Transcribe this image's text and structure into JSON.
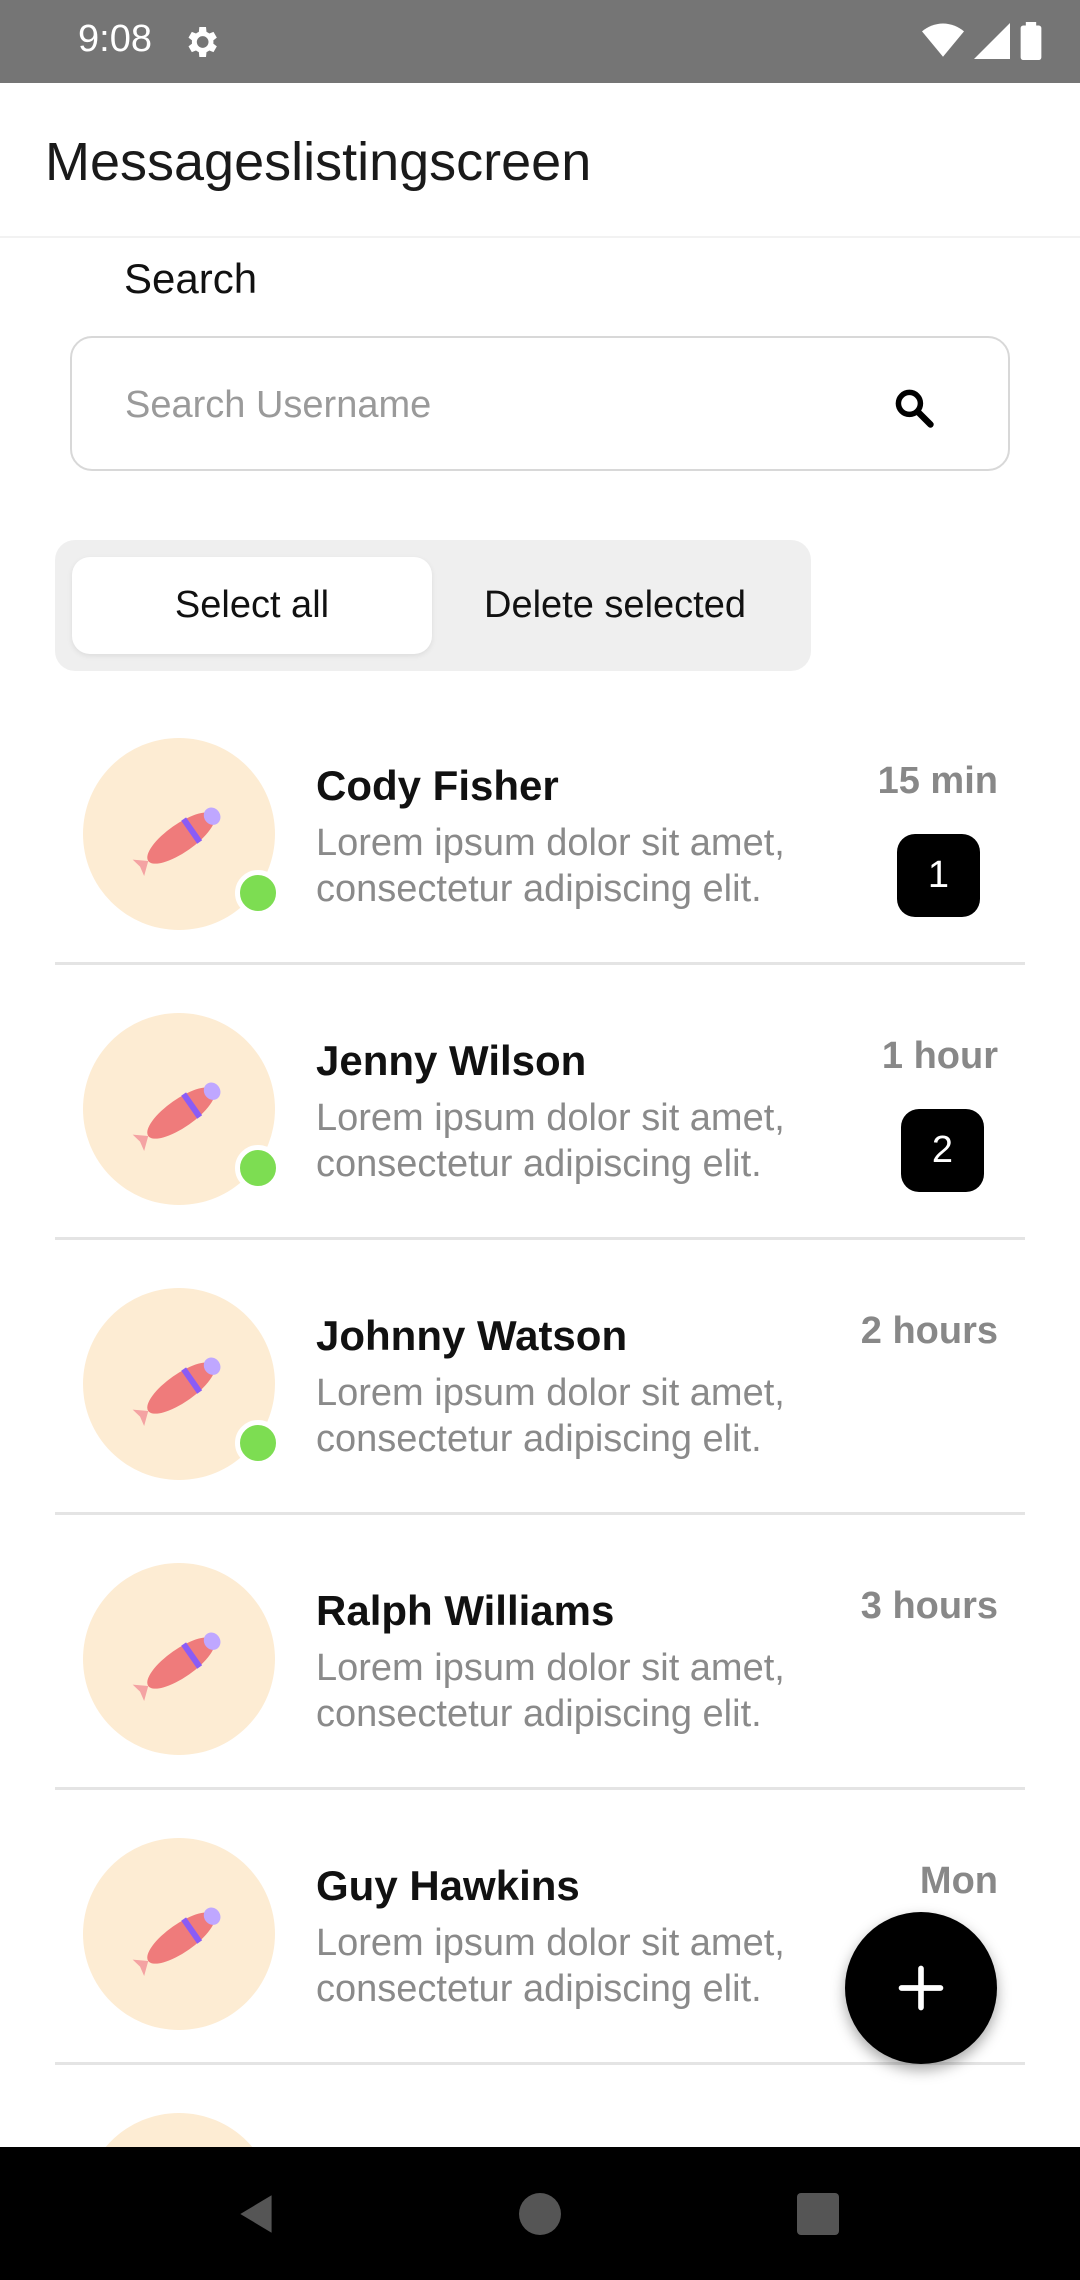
{
  "status_bar": {
    "time": "9:08"
  },
  "app_bar": {
    "title": "Messageslistingscreen"
  },
  "search": {
    "label": "Search",
    "placeholder": "Search Username"
  },
  "segmented": {
    "select_all": "Select all",
    "delete_selected": "Delete selected"
  },
  "messages": [
    {
      "name": "Cody Fisher",
      "preview": "Lorem ipsum dolor sit amet, consectetur adipiscing elit.",
      "time": "15 min",
      "unread": "1",
      "online": true
    },
    {
      "name": "Jenny Wilson",
      "preview": "Lorem ipsum dolor sit amet, consectetur adipiscing elit.",
      "time": "1 hour",
      "unread": "2",
      "online": true
    },
    {
      "name": "Johnny Watson",
      "preview": "Lorem ipsum dolor sit amet, consectetur adipiscing elit.",
      "time": "2 hours",
      "unread": "",
      "online": true
    },
    {
      "name": "Ralph Williams",
      "preview": "Lorem ipsum dolor sit amet, consectetur adipiscing elit.",
      "time": "3 hours",
      "unread": "",
      "online": false
    },
    {
      "name": "Guy Hawkins",
      "preview": "Lorem ipsum dolor sit amet, consectetur adipiscing elit.",
      "time": "Mon",
      "unread": "",
      "online": false
    }
  ],
  "icons": {
    "status": [
      "gear-icon",
      "wifi-icon",
      "signal-icon",
      "battery-icon"
    ],
    "search": "search-icon",
    "avatar": "rocket-icon",
    "fab": "plus-icon",
    "nav": [
      "back-icon",
      "home-icon",
      "recents-icon"
    ]
  },
  "colors": {
    "online": "#7ddd52",
    "avatar_bg": "#fdecd3",
    "badge_bg": "#000000",
    "fab_bg": "#000000"
  }
}
